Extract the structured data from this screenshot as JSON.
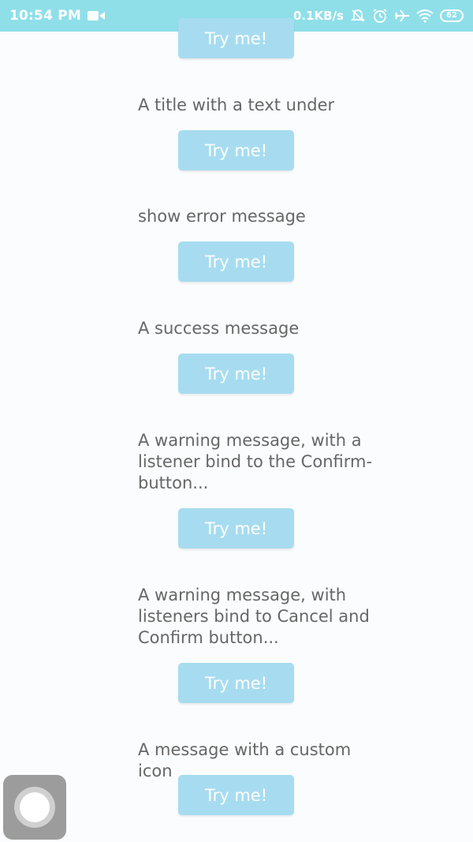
{
  "status_bar": {
    "time": "10:54 PM",
    "network_speed": "0.1KB/s",
    "battery_level": "62",
    "icons": [
      "video-camera-icon",
      "mute-icon",
      "alarm-icon",
      "airplane-icon",
      "wifi-icon",
      "battery-icon"
    ],
    "background_color": "#8fdfe9"
  },
  "items": [
    {
      "label": "",
      "button": "Try me!"
    },
    {
      "label": "A title with a text under",
      "button": "Try me!"
    },
    {
      "label": "show error message",
      "button": "Try me!"
    },
    {
      "label": "A success message",
      "button": "Try me!"
    },
    {
      "label": "A warning message, with a listener bind to the Confirm-button...",
      "button": "Try me!"
    },
    {
      "label": "A warning message, with listeners bind to Cancel and Confirm button...",
      "button": "Try me!"
    },
    {
      "label": "A message with a custom icon",
      "button": "Try me!"
    }
  ],
  "colors": {
    "button_bg": "#a7dcf0",
    "label_text": "#666666"
  },
  "assistive_touch": {
    "icon": "assistive-touch-icon"
  }
}
